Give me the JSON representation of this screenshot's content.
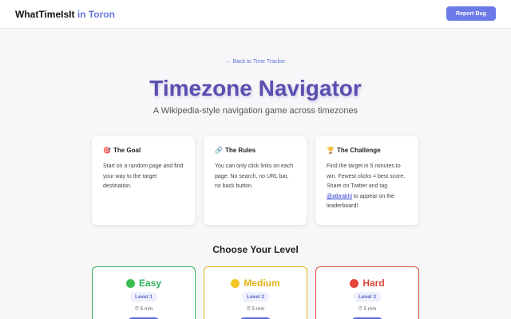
{
  "header": {
    "brand": "WhatTimeIsIt",
    "city": "in Toron",
    "report_label": "Report Bug"
  },
  "hero": {
    "back_link": "← Back to Time Tracker",
    "title": "Timezone Navigator",
    "subtitle": "A Wikipedia-style navigation game across timezones"
  },
  "cards": [
    {
      "icon": "🎯",
      "icon_name": "target-icon",
      "title": "The Goal",
      "body": "Start on a random page and find your way to the target destination."
    },
    {
      "icon": "🔗",
      "icon_name": "link-icon",
      "title": "The Rules",
      "body": "You can only click links on each page. No search, no URL bar, no back button."
    },
    {
      "icon": "🏆",
      "icon_name": "trophy-icon",
      "title": "The Challenge",
      "body_before": "Find the target in 5 minutes to win. Fewest clicks = best score. Share on Twitter and tag ",
      "handle": "@atbrakhi",
      "body_after": " to appear on the leaderboard!"
    }
  ],
  "levels_heading": "Choose Your Level",
  "levels": [
    {
      "name": "Easy",
      "badge": "Level 1",
      "time": "⏱ 5 min",
      "color": "#2fb35a",
      "dot": "#3bbf4f"
    },
    {
      "name": "Medium",
      "badge": "Level 2",
      "time": "⏱ 5 min",
      "color": "#e2b318",
      "dot": "#f3c623"
    },
    {
      "name": "Hard",
      "badge": "Level 3",
      "time": "⏱ 5 min",
      "color": "#d9463c",
      "dot": "#e5443a"
    }
  ]
}
